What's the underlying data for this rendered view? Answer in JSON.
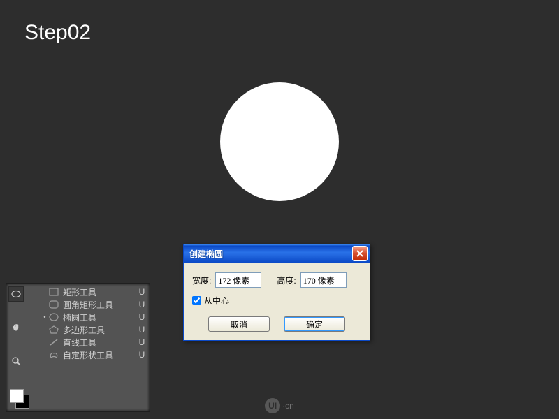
{
  "step_label": "Step02",
  "watermark": {
    "logo_text": "UI",
    "suffix": "·cn"
  },
  "tools": {
    "toolbar_icons": [
      "ellipse",
      "hand",
      "zoom",
      "none"
    ],
    "selected_toolbar_index": 0,
    "swatches": {
      "fg": "#ffffff",
      "bg": "#000000"
    },
    "shape_list": [
      {
        "id": "rect",
        "label": "矩形工具",
        "shortcut": "U",
        "selected": false
      },
      {
        "id": "rounded",
        "label": "圆角矩形工具",
        "shortcut": "U",
        "selected": false
      },
      {
        "id": "ellipse",
        "label": "椭圆工具",
        "shortcut": "U",
        "selected": true
      },
      {
        "id": "polygon",
        "label": "多边形工具",
        "shortcut": "U",
        "selected": false
      },
      {
        "id": "line",
        "label": "直线工具",
        "shortcut": "U",
        "selected": false
      },
      {
        "id": "custom",
        "label": "自定形状工具",
        "shortcut": "U",
        "selected": false
      }
    ]
  },
  "dialog": {
    "title": "创建椭圆",
    "width_label": "宽度:",
    "width_value": "172 像素",
    "height_label": "高度:",
    "height_value": "170 像素",
    "from_center_label": "从中心",
    "from_center_checked": true,
    "cancel_label": "取消",
    "ok_label": "确定"
  }
}
